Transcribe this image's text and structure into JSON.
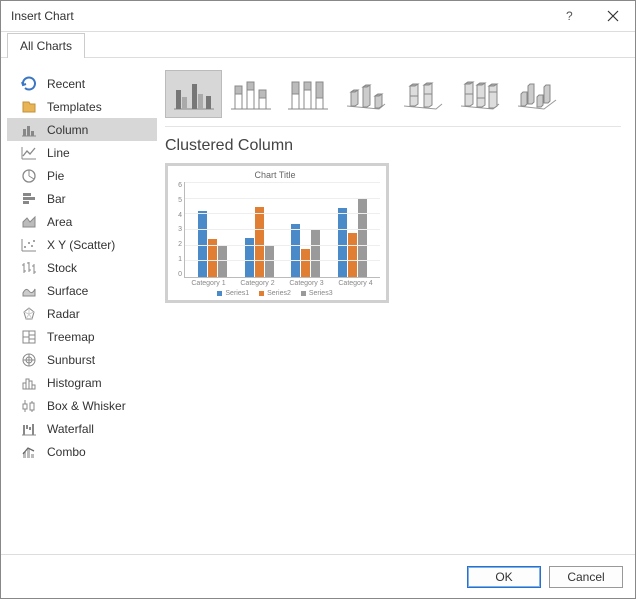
{
  "window": {
    "title": "Insert Chart"
  },
  "tabs": {
    "active": "All Charts"
  },
  "sidebar": {
    "items": [
      {
        "label": "Recent"
      },
      {
        "label": "Templates"
      },
      {
        "label": "Column"
      },
      {
        "label": "Line"
      },
      {
        "label": "Pie"
      },
      {
        "label": "Bar"
      },
      {
        "label": "Area"
      },
      {
        "label": "X Y (Scatter)"
      },
      {
        "label": "Stock"
      },
      {
        "label": "Surface"
      },
      {
        "label": "Radar"
      },
      {
        "label": "Treemap"
      },
      {
        "label": "Sunburst"
      },
      {
        "label": "Histogram"
      },
      {
        "label": "Box & Whisker"
      },
      {
        "label": "Waterfall"
      },
      {
        "label": "Combo"
      }
    ],
    "selected_index": 2
  },
  "subtype": {
    "selected_index": 0,
    "selected_label": "Clustered Column"
  },
  "footer": {
    "ok": "OK",
    "cancel": "Cancel"
  },
  "chart_data": {
    "type": "bar",
    "title": "Chart Title",
    "categories": [
      "Category 1",
      "Category 2",
      "Category 3",
      "Category 4"
    ],
    "series": [
      {
        "name": "Series1",
        "color": "#4a8ac9",
        "values": [
          4.2,
          2.5,
          3.4,
          4.4
        ]
      },
      {
        "name": "Series2",
        "color": "#e07f33",
        "values": [
          2.4,
          4.5,
          1.8,
          2.8
        ]
      },
      {
        "name": "Series3",
        "color": "#9a9a9a",
        "values": [
          2.0,
          2.0,
          3.0,
          5.0
        ]
      }
    ],
    "ylim": [
      0,
      6
    ],
    "yticks": [
      0,
      1,
      2,
      3,
      4,
      5,
      6
    ],
    "xlabel": "",
    "ylabel": ""
  }
}
